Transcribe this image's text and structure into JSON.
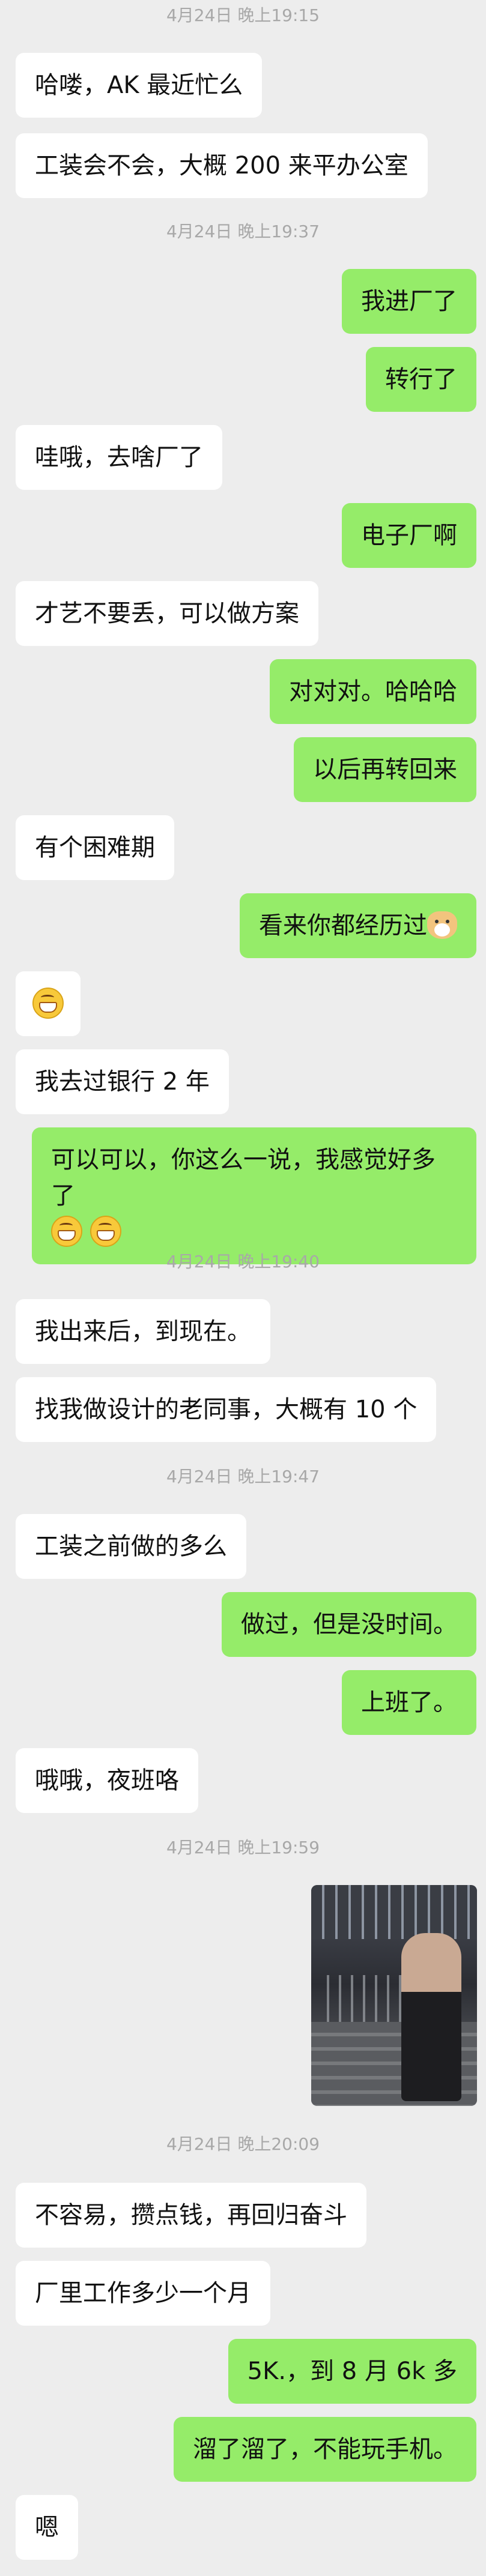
{
  "messages": [
    {
      "type": "time",
      "text": "4月24日 晚上19:15"
    },
    {
      "type": "in",
      "text": "哈喽，AK 最近忙么"
    },
    {
      "type": "in",
      "text": "工装会不会，大概 200 来平办公室"
    },
    {
      "type": "time",
      "text": "4月24日 晚上19:37"
    },
    {
      "type": "out",
      "text": "我进厂了"
    },
    {
      "type": "out",
      "text": "转行了"
    },
    {
      "type": "in",
      "text": "哇哦，去啥厂了"
    },
    {
      "type": "out",
      "text": "电子厂啊"
    },
    {
      "type": "in",
      "text": "才艺不要丢，可以做方案"
    },
    {
      "type": "out",
      "text": "对对对。哈哈哈"
    },
    {
      "type": "out",
      "text": "以后再转回来"
    },
    {
      "type": "in",
      "text": "有个困难期"
    },
    {
      "type": "out",
      "text": "看来你都经历过",
      "emoji": "doge-emoji"
    },
    {
      "type": "in",
      "text": "",
      "emoji": "grin-emoji"
    },
    {
      "type": "in",
      "text": "我去过银行 2 年"
    },
    {
      "type": "out",
      "text": "可以可以，你这么一说，我感觉好多了",
      "emoji": "grin-emoji x2"
    },
    {
      "type": "time",
      "text": "4月24日 晚上19:40"
    },
    {
      "type": "in",
      "text": "我出来后，到现在。"
    },
    {
      "type": "in",
      "text": "找我做设计的老同事，大概有 10 个"
    },
    {
      "type": "time",
      "text": "4月24日 晚上19:47"
    },
    {
      "type": "in",
      "text": "工装之前做的多么"
    },
    {
      "type": "out",
      "text": "做过，但是没时间。"
    },
    {
      "type": "out",
      "text": "上班了。"
    },
    {
      "type": "in",
      "text": "哦哦，夜班咯"
    },
    {
      "type": "time",
      "text": "4月24日 晚上19:59"
    },
    {
      "type": "out",
      "text": "",
      "image": "photo-of-stairs"
    },
    {
      "type": "time",
      "text": "4月24日 晚上20:09"
    },
    {
      "type": "in",
      "text": "不容易，攒点钱，再回归奋斗"
    },
    {
      "type": "in",
      "text": "厂里工作多少一个月"
    },
    {
      "type": "out",
      "text": "5K.，到 8 月 6k 多"
    },
    {
      "type": "out",
      "text": "溜了溜了，不能玩手机。"
    },
    {
      "type": "in",
      "text": "嗯"
    }
  ],
  "colors": {
    "background": "#ededed",
    "incoming": "#ffffff",
    "outgoing": "#95ec69",
    "timestamp": "#a8a8a8"
  }
}
